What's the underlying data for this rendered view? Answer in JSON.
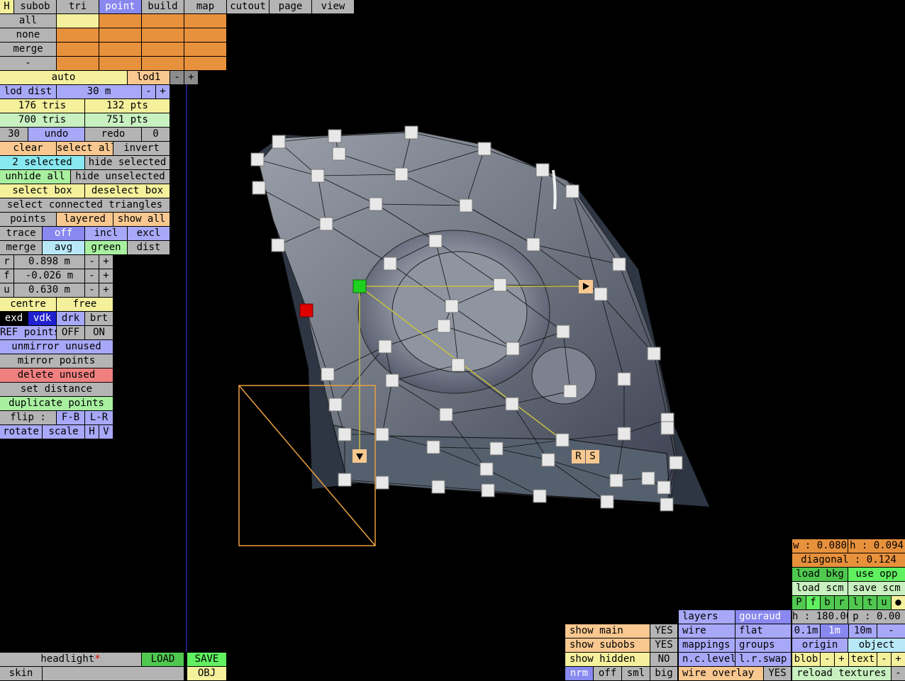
{
  "top_tabs": [
    "H",
    "subob",
    "tri",
    "point",
    "build",
    "map",
    "cutout",
    "page",
    "view"
  ],
  "active_tab": "point",
  "sel_labels": [
    "all",
    "none",
    "merge",
    "-"
  ],
  "auto": {
    "label": "auto",
    "lod": "lod1",
    "minus": "-",
    "plus": "+"
  },
  "lod_dist": {
    "label": "lod dist",
    "value": "30 m",
    "minus": "-",
    "plus": "+"
  },
  "stats": {
    "tris1": "176 tris",
    "pts1": "132 pts",
    "tris2": "700 tris",
    "pts2": "751 pts"
  },
  "undo_row": {
    "left": "30",
    "undo": "undo",
    "redo": "redo",
    "right": "0"
  },
  "sel_row": {
    "clear": "clear",
    "select_all": "select all",
    "invert": "invert"
  },
  "selected_row": {
    "selected": "2 selected",
    "hide_selected": "hide selected"
  },
  "unhide_row": {
    "unhide_all": "unhide all",
    "hide_unselected": "hide unselected"
  },
  "box_row": {
    "select_box": "select box",
    "deselect_box": "deselect box"
  },
  "connected": "select connected triangles",
  "points_row": {
    "points": "points",
    "layered": "layered",
    "show_all": "show all"
  },
  "trace_row": {
    "trace": "trace",
    "off": "off",
    "incl": "incl",
    "excl": "excl"
  },
  "merge_row": {
    "merge": "merge",
    "avg": "avg",
    "green": "green",
    "dist": "dist"
  },
  "coords": [
    {
      "axis": "r",
      "value": "0.898 m"
    },
    {
      "axis": "f",
      "value": "-0.026 m"
    },
    {
      "axis": "u",
      "value": "0.630 m"
    }
  ],
  "pm": {
    "minus": "-",
    "plus": "+"
  },
  "centre_row": {
    "centre": "centre",
    "free": "free"
  },
  "shade_row": {
    "exd": "exd",
    "vdk": "vdk",
    "drk": "drk",
    "brt": "brt"
  },
  "ref_row": {
    "label": "REF points",
    "off": "OFF",
    "on": "ON"
  },
  "actions": {
    "unmirror": "unmirror unused",
    "mirror": "mirror points",
    "delete": "delete unused",
    "set_distance": "set distance",
    "duplicate": "duplicate points"
  },
  "flip_row": {
    "flip": "flip :",
    "fb": "F-B",
    "lr": "L-R"
  },
  "rotate_row": {
    "rotate": "rotate",
    "scale": "scale",
    "h": "H",
    "v": "V"
  },
  "bottom_left": {
    "headlight": "headlight",
    "star": "*",
    "load": "LOAD",
    "save": "SAVE",
    "skin": "skin",
    "obj": "OBJ"
  },
  "viewport_markers": {
    "r": "R",
    "s": "S"
  },
  "right_panel": {
    "w": "w : 0.080",
    "h": "h : 0.094",
    "diagonal": "diagonal : 0.124",
    "load_bkg": "load bkg",
    "use_opp": "use opp",
    "load_scm": "load scm",
    "save_scm": "save scm",
    "pflags": [
      "P",
      "f",
      "b",
      "r",
      "l",
      "t",
      "u",
      "●"
    ],
    "heading": "h : 180.00",
    "pitch": "p : 0.00",
    "steps": [
      "0.1m",
      "1m",
      "10m",
      "-"
    ],
    "origin": "origin",
    "object": "object",
    "blob": "blob",
    "text": "text",
    "minus": "-",
    "plus": "+",
    "reload": "reload textures",
    "reload_minus": "-"
  },
  "display_panel": {
    "layers": "layers",
    "gouraud": "gouraud",
    "wire": "wire",
    "flat": "flat",
    "mappings": "mappings",
    "groups": "groups",
    "nclevel": "n.c.level",
    "lrswap": "l.r.swap",
    "wire_overlay": "wire overlay",
    "yes": "YES"
  },
  "show_panel": {
    "show_main": "show main",
    "show_main_val": "YES",
    "show_subobs": "show subobs",
    "show_subobs_val": "YES",
    "show_hidden": "show hidden",
    "show_hidden_val": "NO",
    "sizes": [
      "nrm",
      "off",
      "sml",
      "big"
    ]
  }
}
